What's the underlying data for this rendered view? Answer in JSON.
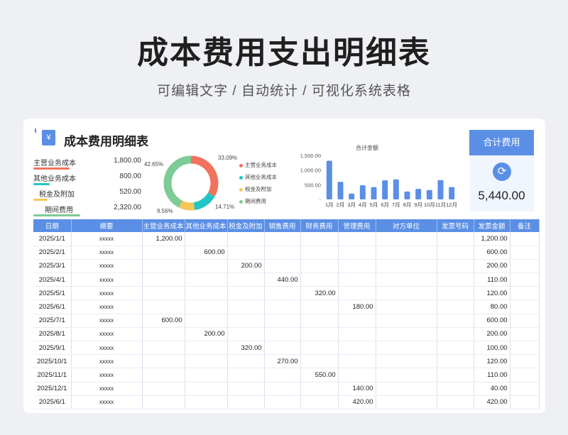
{
  "page": {
    "title": "成本费用支出明细表",
    "subtitle": "可编辑文字 / 自动统计 / 可视化系统表格"
  },
  "sheet": {
    "title": "成本费用明细表",
    "icon": "yen-icon"
  },
  "summary": [
    {
      "label": "主营业务成本",
      "value": "1,800.00",
      "color": "#f0735d"
    },
    {
      "label": "其他业务成本",
      "value": "800.00",
      "color": "#22c5c5"
    },
    {
      "label": "税金及附加",
      "value": "520.00",
      "color": "#f5c65b"
    },
    {
      "label": "期间费用",
      "value": "2,320.00",
      "color": "#7dcb96"
    }
  ],
  "donut": {
    "labels": [
      "33.09%",
      "14.71%",
      "9.56%",
      "42.65%"
    ],
    "legend": [
      "主营业务成本",
      "其他业务成本",
      "税金及附加",
      "期间费用"
    ]
  },
  "chart_data": [
    {
      "type": "pie",
      "categories": [
        "主营业务成本",
        "其他业务成本",
        "税金及附加",
        "期间费用"
      ],
      "values": [
        1800,
        800,
        520,
        2320
      ],
      "percent_labels": [
        "33.09%",
        "14.71%",
        "9.56%",
        "42.65%"
      ],
      "colors": [
        "#f0735d",
        "#22c5c5",
        "#f5c65b",
        "#7dcb96"
      ],
      "legend_placement": "right"
    },
    {
      "type": "bar",
      "title": "合计金额",
      "categories": [
        "1月",
        "2月",
        "3月",
        "4月",
        "5月",
        "6月",
        "7月",
        "8月",
        "9月",
        "10月",
        "11月",
        "12月"
      ],
      "values": [
        1320,
        600,
        200,
        480,
        420,
        650,
        680,
        270,
        360,
        320,
        660,
        420
      ],
      "ylim": [
        0,
        1500
      ],
      "yticks": [
        "-",
        "500.00",
        "1,000.00",
        "1,500.00"
      ],
      "color": "#5b8fe6"
    }
  ],
  "total": {
    "header": "合计费用",
    "value": "5,440.00"
  },
  "table": {
    "headers": [
      "日期",
      "摘要",
      "主营业务成本",
      "其他业务成本",
      "税金及附加",
      "销售费用",
      "财务费用",
      "管理费用",
      "对方单位",
      "发票号码",
      "发票金额",
      "备注"
    ],
    "rows": [
      [
        "2025/1/1",
        "xxxxx",
        "1,200.00",
        "",
        "",
        "",
        "",
        "",
        "",
        "",
        "1,200.00",
        ""
      ],
      [
        "2025/2/1",
        "xxxxx",
        "",
        "600.00",
        "",
        "",
        "",
        "",
        "",
        "",
        "600.00",
        ""
      ],
      [
        "2025/3/1",
        "xxxxx",
        "",
        "",
        "200.00",
        "",
        "",
        "",
        "",
        "",
        "200.00",
        ""
      ],
      [
        "2025/4/1",
        "xxxxx",
        "",
        "",
        "",
        "440.00",
        "",
        "",
        "",
        "",
        "110.00",
        ""
      ],
      [
        "2025/5/1",
        "xxxxx",
        "",
        "",
        "",
        "",
        "320.00",
        "",
        "",
        "",
        "120.00",
        ""
      ],
      [
        "2025/6/1",
        "xxxxx",
        "",
        "",
        "",
        "",
        "",
        "180.00",
        "",
        "",
        "80.00",
        ""
      ],
      [
        "2025/7/1",
        "xxxxx",
        "600.00",
        "",
        "",
        "",
        "",
        "",
        "",
        "",
        "600.00",
        ""
      ],
      [
        "2025/8/1",
        "xxxxx",
        "",
        "200.00",
        "",
        "",
        "",
        "",
        "",
        "",
        "200.00",
        ""
      ],
      [
        "2025/9/1",
        "xxxxx",
        "",
        "",
        "320.00",
        "",
        "",
        "",
        "",
        "",
        "100.00",
        ""
      ],
      [
        "2025/10/1",
        "xxxxx",
        "",
        "",
        "",
        "270.00",
        "",
        "",
        "",
        "",
        "120.00",
        ""
      ],
      [
        "2025/11/1",
        "xxxxx",
        "",
        "",
        "",
        "",
        "550.00",
        "",
        "",
        "",
        "110.00",
        ""
      ],
      [
        "2025/12/1",
        "xxxxx",
        "",
        "",
        "",
        "",
        "",
        "140.00",
        "",
        "",
        "40.00",
        ""
      ],
      [
        "2025/6/1",
        "xxxxx",
        "",
        "",
        "",
        "",
        "",
        "420.00",
        "",
        "",
        "420.00",
        ""
      ]
    ]
  }
}
